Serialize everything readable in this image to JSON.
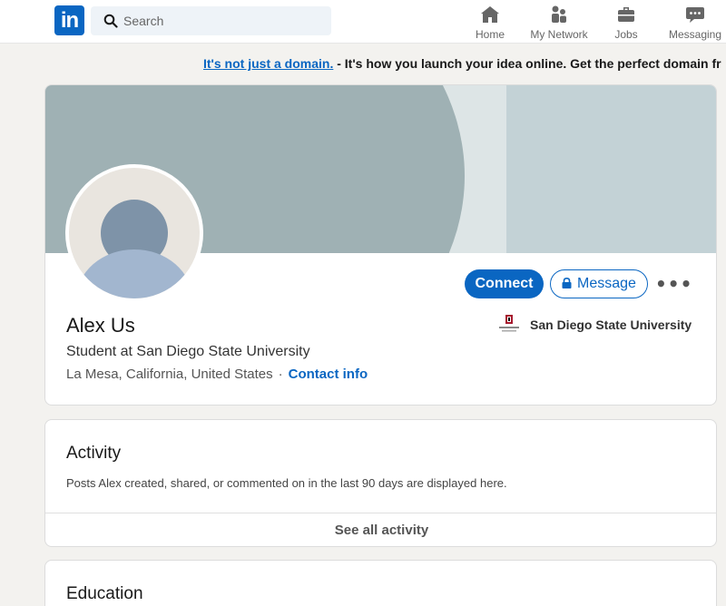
{
  "nav": {
    "logo_text": "in",
    "search_placeholder": "Search",
    "items": [
      {
        "label": "Home",
        "icon": "home-icon"
      },
      {
        "label": "My Network",
        "icon": "network-icon"
      },
      {
        "label": "Jobs",
        "icon": "briefcase-icon"
      },
      {
        "label": "Messaging",
        "icon": "chat-icon"
      }
    ]
  },
  "ad": {
    "link_text": "It's not just a domain.",
    "rest_text": " - It's how you launch your idea online. Get the perfect domain fr"
  },
  "profile": {
    "name": "Alex Us",
    "headline": "Student at San Diego State University",
    "location": "La Mesa, California, United States",
    "separator": "·",
    "contact_label": "Contact info",
    "connect_label": "Connect",
    "message_label": "Message",
    "more_label": "•••",
    "school_name": "San Diego State University"
  },
  "activity": {
    "title": "Activity",
    "description": "Posts Alex created, shared, or commented on in the last 90 days are displayed here.",
    "see_all_label": "See all activity"
  },
  "education": {
    "title": "Education"
  },
  "colors": {
    "brand": "#0a66c2",
    "background": "#f3f2ef",
    "cover": "#9fb1b4"
  }
}
